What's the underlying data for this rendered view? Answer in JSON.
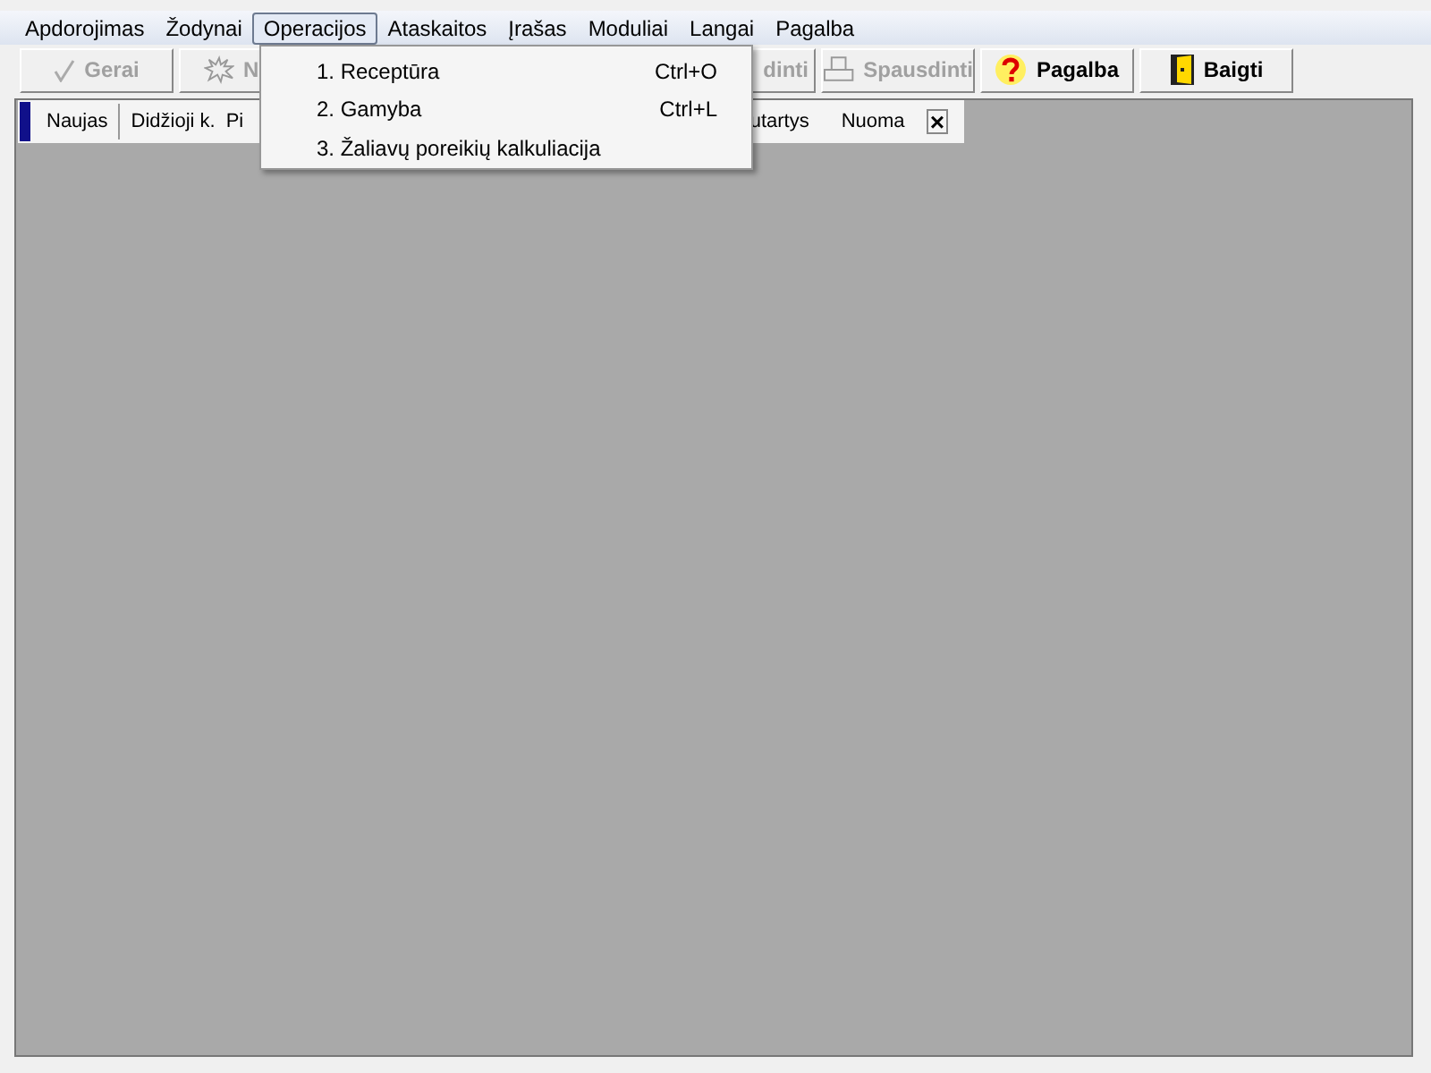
{
  "menu_bar": [
    {
      "label": "Apdorojimas",
      "selected": false
    },
    {
      "label": "Žodynai",
      "selected": false
    },
    {
      "label": "Operacijos",
      "selected": true
    },
    {
      "label": "Ataskaitos",
      "selected": false
    },
    {
      "label": "Įrašas",
      "selected": false
    },
    {
      "label": "Moduliai",
      "selected": false
    },
    {
      "label": "Langai",
      "selected": false
    },
    {
      "label": "Pagalba",
      "selected": false
    }
  ],
  "toolbar": [
    {
      "label": "Gerai",
      "kind": "check",
      "disabled": true
    },
    {
      "label": "N",
      "kind": "burst",
      "disabled": true
    },
    {
      "label": "dinti",
      "kind": "plain",
      "disabled": true
    },
    {
      "label": "Spausdinti",
      "kind": "printer",
      "disabled": true
    },
    {
      "label": "Pagalba",
      "kind": "question",
      "disabled": false
    },
    {
      "label": "Baigti",
      "kind": "door",
      "disabled": false
    }
  ],
  "dropdown": [
    {
      "label": "1. Receptūra",
      "shortcut": "Ctrl+O"
    },
    {
      "label": "2. Gamyba",
      "shortcut": "Ctrl+L"
    },
    {
      "label": "3. Žaliavų poreikių kalkuliacija"
    }
  ],
  "floating_toolbar": {
    "items": [
      "Naujas",
      "Didžioji k.",
      "Pi",
      "utartys",
      "Nuoma"
    ],
    "close": "×"
  }
}
